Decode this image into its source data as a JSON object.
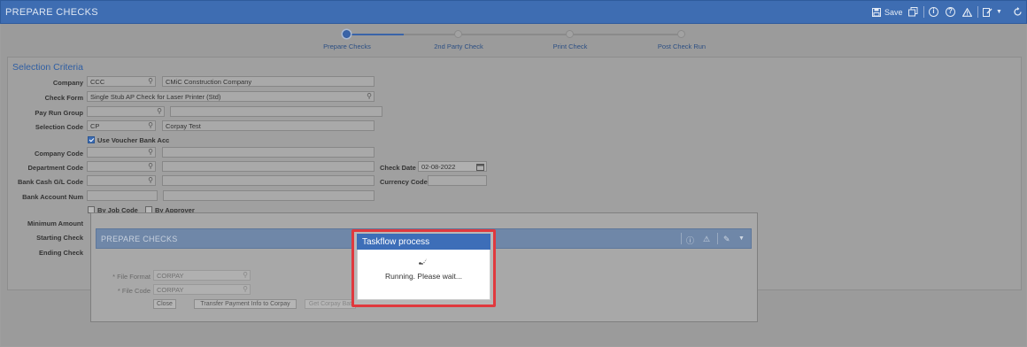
{
  "app": {
    "title": "PREPARE CHECKS"
  },
  "toolbar": {
    "save_label": "Save"
  },
  "steps": [
    {
      "label": "Prepare Checks",
      "active": true
    },
    {
      "label": "2nd Party Check",
      "active": false
    },
    {
      "label": "Print Check",
      "active": false
    },
    {
      "label": "Post Check Run",
      "active": false
    }
  ],
  "section": {
    "title": "Selection Criteria"
  },
  "form": {
    "company": {
      "label": "Company",
      "code": "CCC",
      "name": "CMiC Construction Company"
    },
    "check_form": {
      "label": "Check Form",
      "value": "Single Stub AP Check for Laser Printer (Std)"
    },
    "pay_run_group": {
      "label": "Pay Run Group"
    },
    "selection_code": {
      "label": "Selection Code",
      "code": "CP",
      "name": "Corpay Test"
    },
    "use_voucher_bank": {
      "label": "Use Voucher Bank Acc",
      "checked": true
    },
    "company_code": {
      "label": "Company Code"
    },
    "department_code": {
      "label": "Department Code"
    },
    "check_date": {
      "label": "Check Date",
      "value": "02-08-2022"
    },
    "bank_cash_gl": {
      "label": "Bank Cash G/L Code"
    },
    "currency_code": {
      "label": "Currency Code"
    },
    "bank_account_num": {
      "label": "Bank Account Num"
    },
    "by_job_code": {
      "label": "By Job Code"
    },
    "by_approver": {
      "label": "By Approver"
    },
    "minimum_amount": {
      "label": "Minimum Amount"
    },
    "starting_check": {
      "label": "Starting Check"
    },
    "ending_check": {
      "label": "Ending Check"
    }
  },
  "subwindow": {
    "title": "PREPARE CHECKS",
    "file_format": {
      "label": "* File Format",
      "value": "CORPAY"
    },
    "file_code": {
      "label": "* File Code",
      "value": "CORPAY"
    },
    "close_label": "Close",
    "transfer_label": "Transfer Payment Info to Corpay",
    "get_label": "Get Corpay Bat"
  },
  "dialog": {
    "title": "Taskflow process",
    "message": "Running. Please wait..."
  },
  "colors": {
    "header": "#3e6db2",
    "dialog_highlight": "#e0393e",
    "accent_text": "#2f5ea3"
  }
}
